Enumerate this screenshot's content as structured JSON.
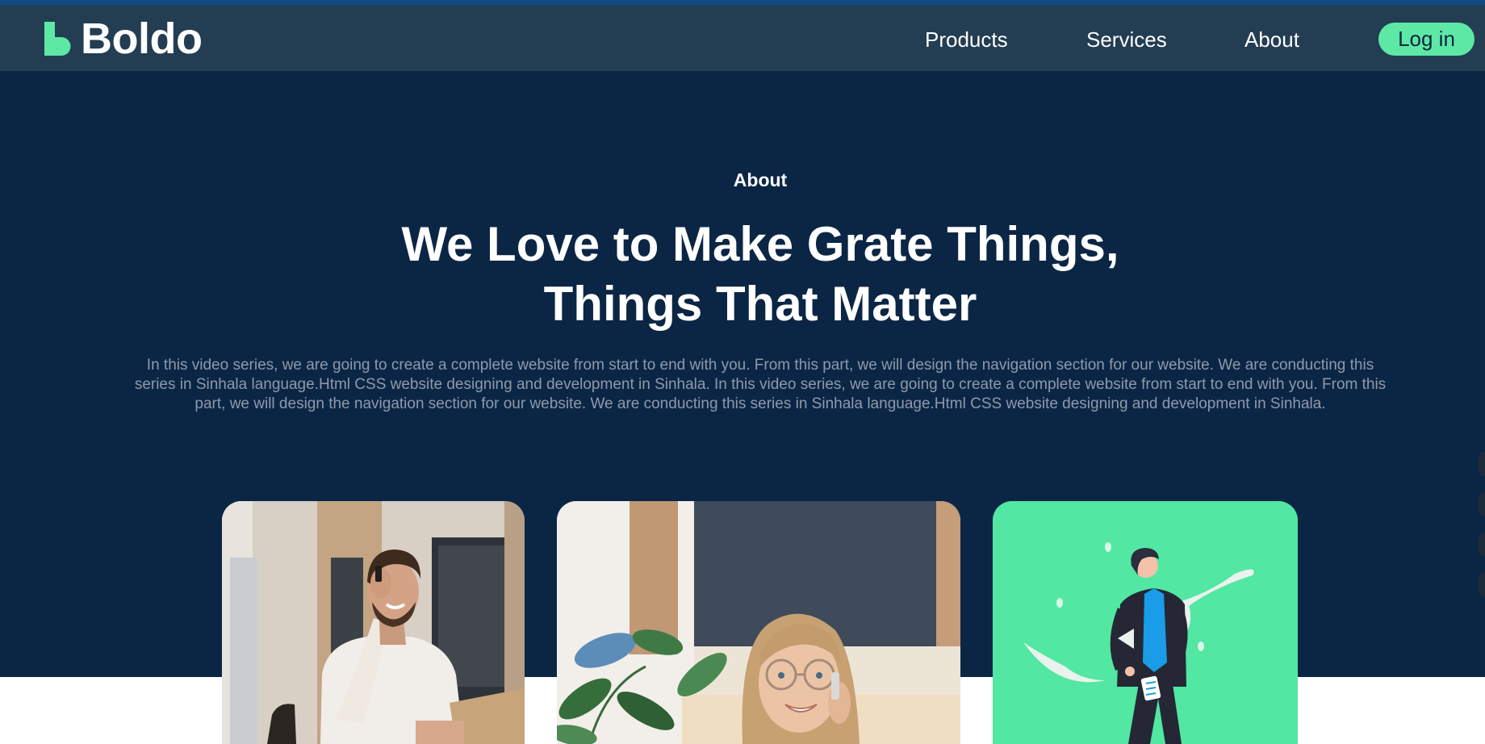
{
  "nav": {
    "brand": "Boldo",
    "links": [
      "Products",
      "Services",
      "About"
    ],
    "login_label": "Log in"
  },
  "hero": {
    "eyebrow": "About",
    "headline_line1": "We Love to Make Grate Things,",
    "headline_line2": "Things That Matter",
    "body": "In this video series, we are going to create a complete website from start to end with you. From this part, we will design the navigation section for our website. We are conducting this series in Sinhala language.Html CSS website designing and development in Sinhala. In this video series, we are going to create a complete website from start to end with you. From this part, we will design the navigation section for our website. We are conducting this series in Sinhala language.Html CSS website designing and development in Sinhala."
  },
  "cards": [
    {
      "kind": "photo",
      "subject": "man-on-phone-photo"
    },
    {
      "kind": "photo",
      "subject": "woman-on-phone-photo"
    },
    {
      "kind": "illustration",
      "subject": "businessman-illustration"
    }
  ],
  "colors": {
    "hero_bg": "#0b2645",
    "navbar_bg": "#233d52",
    "accent": "#5ee8a5",
    "card_green": "#52e7a2",
    "body_text": "#8e9aab"
  }
}
